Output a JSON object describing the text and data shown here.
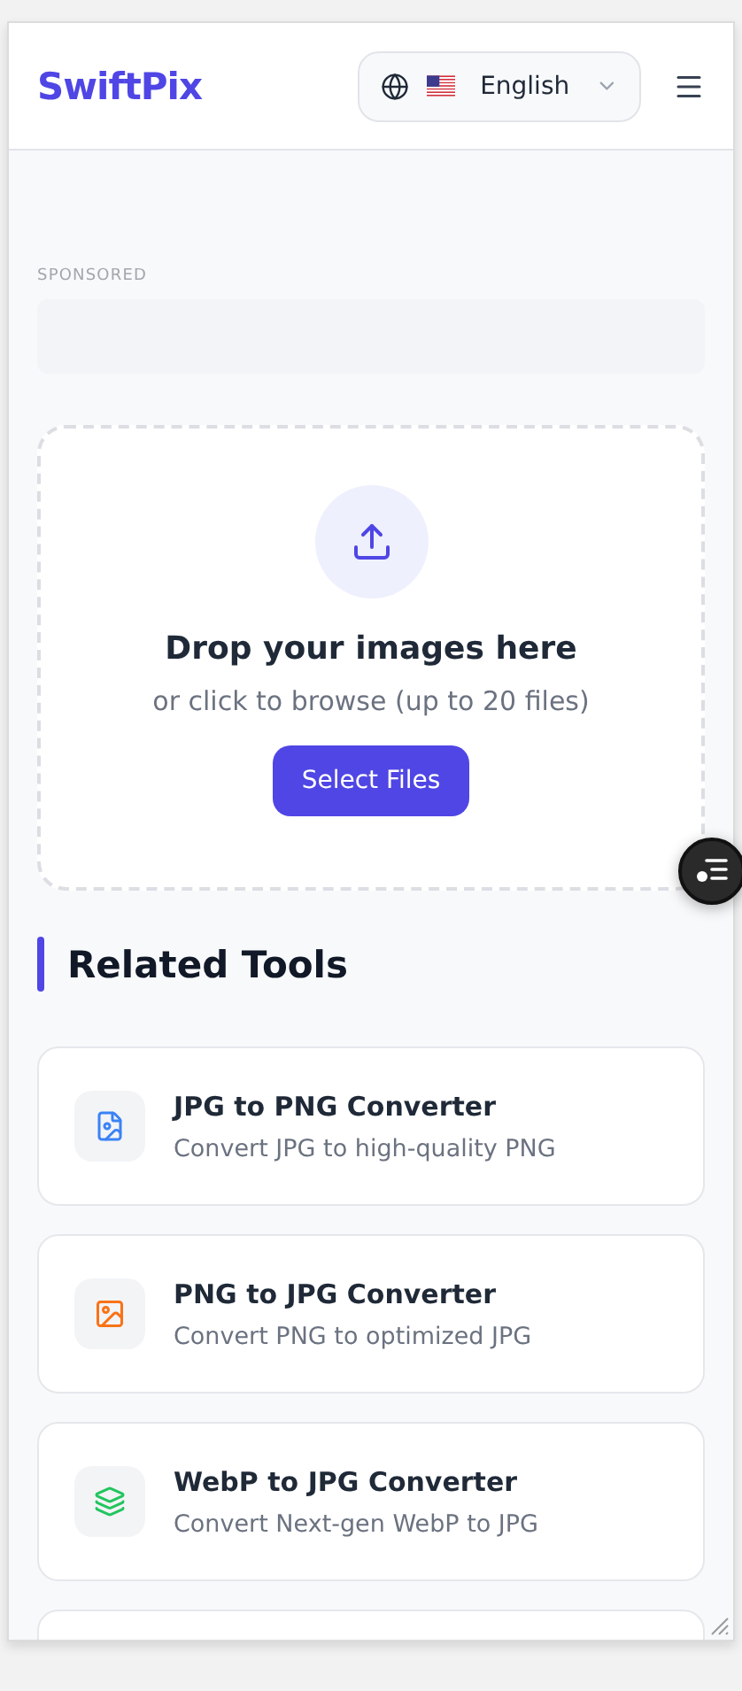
{
  "header": {
    "logo": "SwiftPix",
    "language": {
      "label": "English"
    }
  },
  "sponsored": {
    "label": "SPONSORED"
  },
  "upload": {
    "title": "Drop your images here",
    "subtitle": "or click to browse (up to 20 files)",
    "button": "Select Files"
  },
  "related": {
    "heading": "Related Tools",
    "more_below": true,
    "tools": [
      {
        "kind": "image-file",
        "color": "#3b82f6",
        "title": "JPG to PNG Converter",
        "description": "Convert JPG to high-quality PNG"
      },
      {
        "kind": "image",
        "color": "#f97316",
        "title": "PNG to JPG Converter",
        "description": "Convert PNG to optimized JPG"
      },
      {
        "kind": "layers",
        "color": "#22c55e",
        "title": "WebP to JPG Converter",
        "description": "Convert Next-gen WebP to JPG"
      }
    ]
  }
}
